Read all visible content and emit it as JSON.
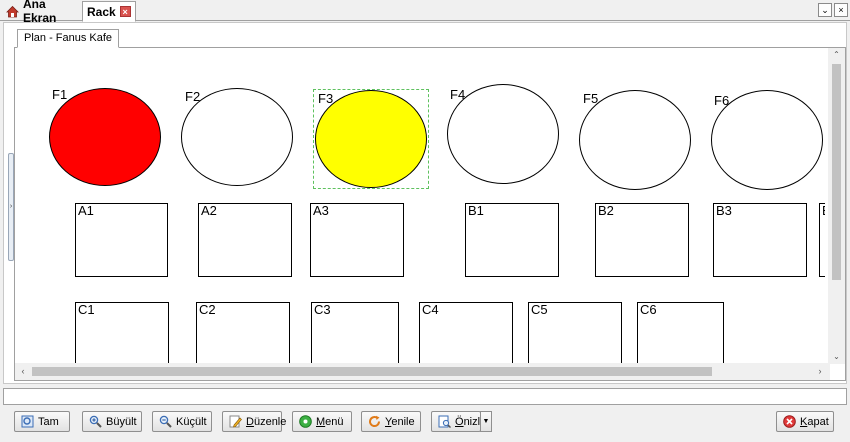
{
  "tabs": [
    {
      "label": "Ana Ekran",
      "icon": "home-icon"
    },
    {
      "label": "Rack",
      "icon": "close-icon",
      "close_glyph": "×"
    }
  ],
  "window_controls": {
    "dropdown": "⌄",
    "close": "×"
  },
  "plan_tab": {
    "label": "Plan - Fanus Kafe"
  },
  "side_handle": "›",
  "colors": {
    "occupied": "#ff0000",
    "reserved": "#ffff00",
    "free": "#ffffff",
    "selection": "#5ec15e"
  },
  "round_tables": [
    {
      "label": "F1",
      "state": "occupied"
    },
    {
      "label": "F2",
      "state": "free"
    },
    {
      "label": "F3",
      "state": "reserved",
      "selected": true
    },
    {
      "label": "F4",
      "state": "free"
    },
    {
      "label": "F5",
      "state": "free"
    },
    {
      "label": "F6",
      "state": "free"
    }
  ],
  "square_tables_row1": [
    "A1",
    "A2",
    "A3",
    "B1",
    "B2",
    "B3",
    "B"
  ],
  "square_tables_row2": [
    "C1",
    "C2",
    "C3",
    "C4",
    "C5",
    "C6"
  ],
  "scroll": {
    "up": "⌃",
    "down": "⌄",
    "left": "‹",
    "right": "›"
  },
  "toolbar": {
    "tam": "Tam",
    "buyult": "Büyült",
    "kucult": "Küçült",
    "duzenle_u": "D",
    "duzenle_rest": "üzenle",
    "menu_u": "M",
    "menu_rest": "enü",
    "yenile_u": "Y",
    "yenile_rest": "enile",
    "onizle_u": "Ö",
    "onizle_rest": "nizle",
    "dropdown": "▼",
    "kapat_u": "K",
    "kapat_rest": "apat"
  }
}
